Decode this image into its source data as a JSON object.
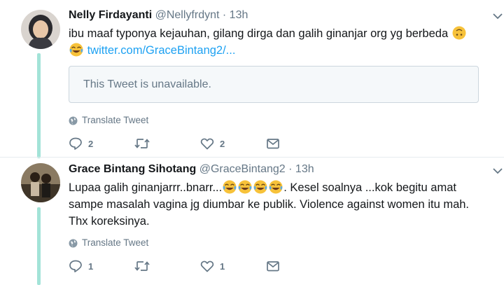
{
  "tweets": [
    {
      "name": "Nelly Firdayanti",
      "handle": "@Nellyfrdynt",
      "separator": "·",
      "time": "13h",
      "text_before_emoji": "ibu maaf typonya kejauhan, gilang dirga dan galih ginanjar org yg berbeda",
      "link": "twitter.com/GraceBintang2/...",
      "quote": "This Tweet is unavailable.",
      "translate": "Translate Tweet",
      "reply_count": "2",
      "retweet_count": "",
      "like_count": "2",
      "emoji_1": "upside-down-face",
      "emoji_2": "face-with-tears-of-joy"
    },
    {
      "name": "Grace Bintang Sihotang",
      "handle": "@GraceBintang2",
      "separator": "·",
      "time": "13h",
      "text_part1": "Lupaa galih ginanjarrr..bnarr...",
      "text_part2": ". Kesel soalnya ...kok begitu amat sampe masalah vagina jg diumbar ke publik. Violence against women itu mah. Thx koreksinya.",
      "translate": "Translate Tweet",
      "reply_count": "1",
      "retweet_count": "",
      "like_count": "1",
      "emoji": "face-with-tears-of-joy"
    }
  ],
  "colors": {
    "thread_line": "#a3e3d8",
    "link": "#1da1f2",
    "muted": "#657786"
  }
}
